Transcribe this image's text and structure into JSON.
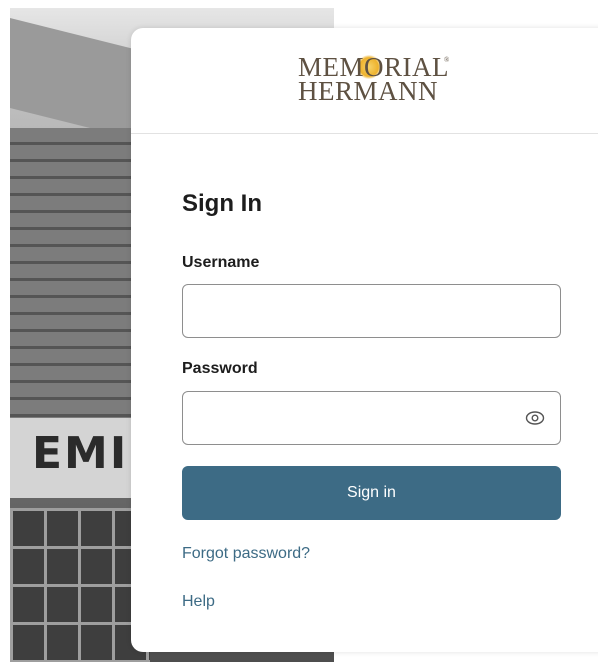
{
  "logo": {
    "line1": "MEMORIAL",
    "line2": "HERMANN",
    "registered": "®"
  },
  "background": {
    "sign_text": "EMI"
  },
  "form": {
    "title": "Sign In",
    "username_label": "Username",
    "username_value": "",
    "password_label": "Password",
    "password_value": "",
    "submit_label": "Sign in"
  },
  "links": {
    "forgot": "Forgot password?",
    "help": "Help"
  },
  "icons": {
    "password_toggle": "eye-icon"
  },
  "colors": {
    "primary": "#3d6b85",
    "text": "#1d1d1d",
    "border": "#8e8e8e",
    "logo_brown": "#5e5142",
    "logo_gold": "#eeb22c"
  }
}
